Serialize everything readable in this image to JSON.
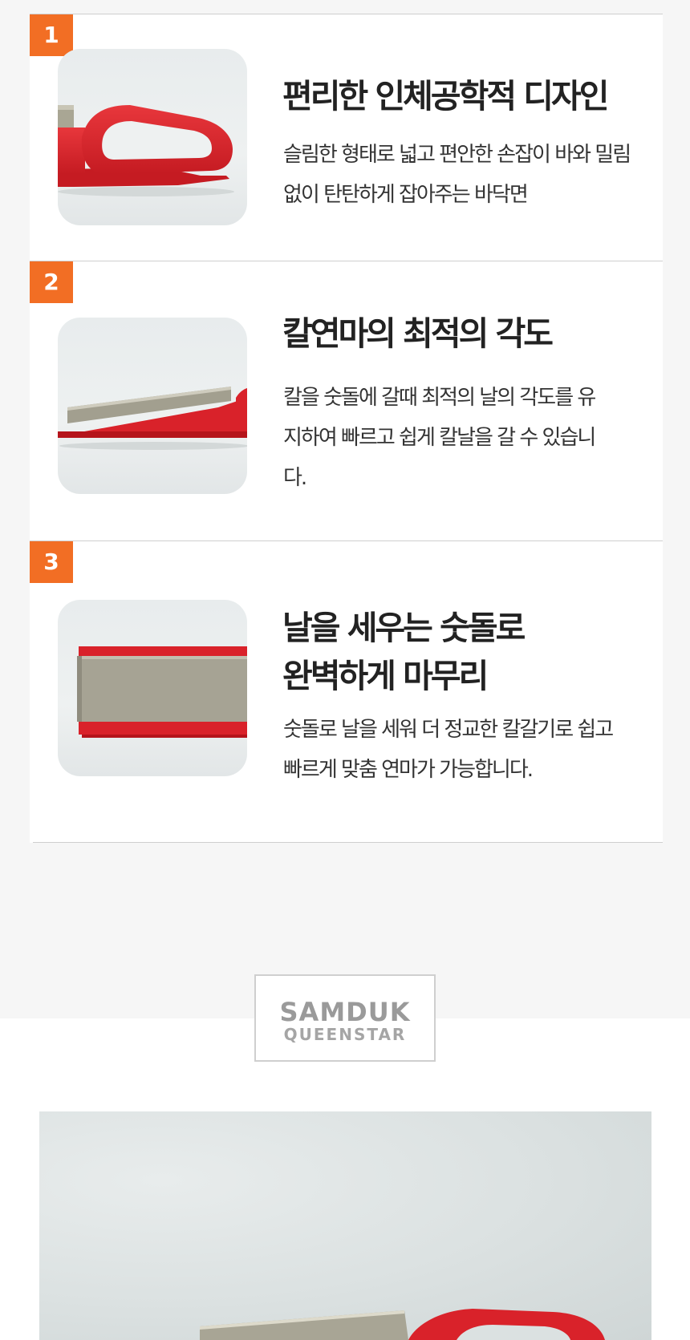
{
  "features": [
    {
      "number": "1",
      "title": "편리한 인체공학적 디자인",
      "description": "슬림한 형태로 넓고 편안한 손잡이 바와 밀림없이 탄탄하게 잡아주는 바닥면",
      "image_alt": "red handle sharpener side view"
    },
    {
      "number": "2",
      "title": "칼연마의 최적의 각도",
      "description": "칼을 숫돌에 갈때 최적의 날의 각도를 유지하여 빠르고 쉽게 칼날을 갈 수 있습니다.",
      "image_alt": "sharpening stone on angled red base"
    },
    {
      "number": "3",
      "title": "날을 세우는 숫돌로 완벽하게 마무리",
      "description": "숫돌로 날을 세워 더 정교한 칼갈기로 쉽고 빠르게 맞춤 연마가 가능합니다.",
      "image_alt": "close-up of sharpening stone"
    }
  ],
  "brand": {
    "main": "SAMDUK",
    "sub": "QUEENSTAR"
  },
  "colors": {
    "accent": "#f26e24",
    "product_red": "#d9222a",
    "stone_gray": "#9f9c8c"
  }
}
